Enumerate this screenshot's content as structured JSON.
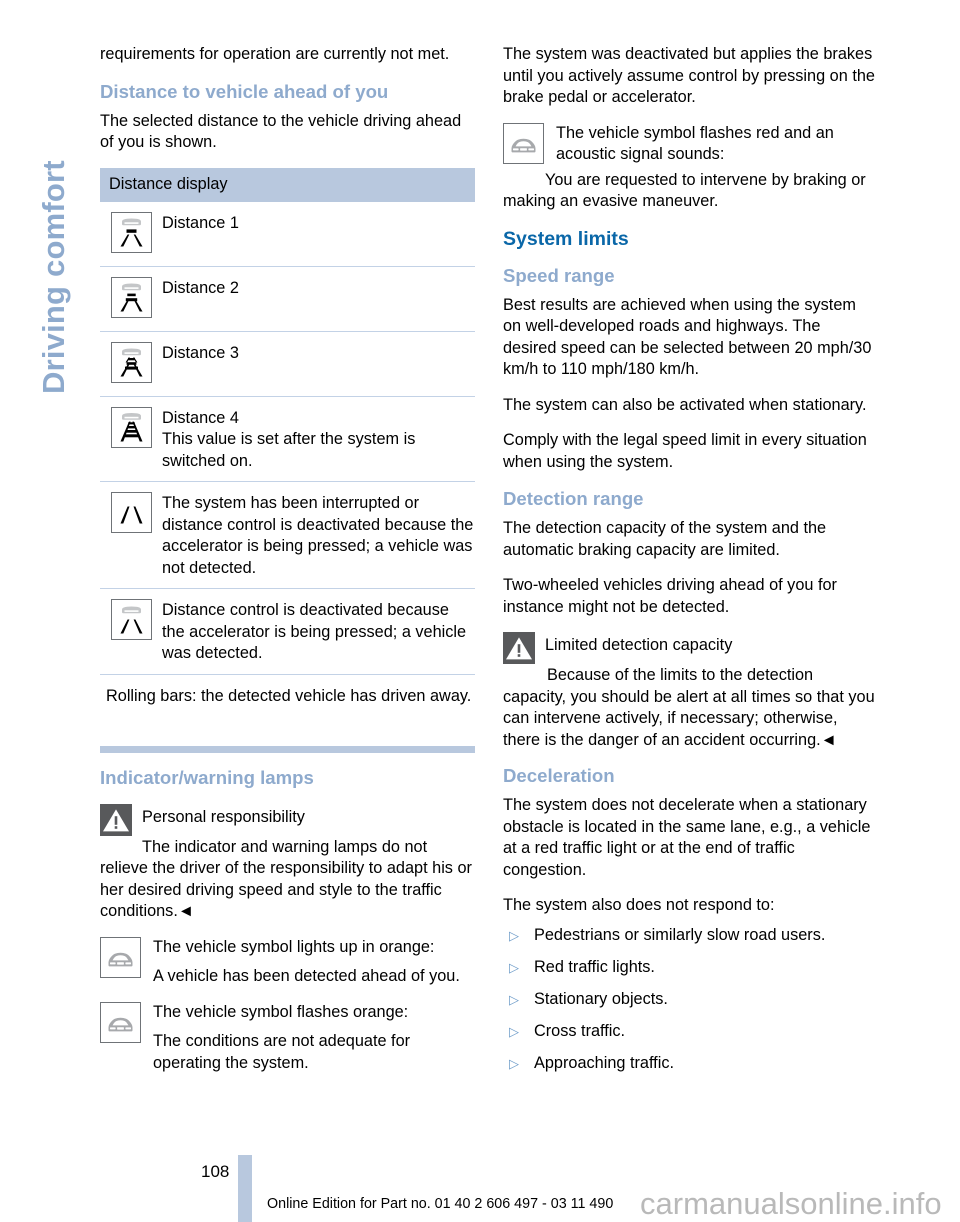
{
  "sidebar": {
    "chapter_label": "Driving comfort",
    "color": "#8eaacd"
  },
  "colors": {
    "head_major": "#0a67a8",
    "head_minor": "#8eaacd",
    "table_header_bg": "#b8c8de",
    "rule": "#c3d2e6",
    "bullet": "#6e9cc9",
    "warn_box": "#58595b",
    "watermark": "#b9b9b9"
  },
  "left_column": {
    "continued_paragraph": "requirements for operation are currently not met.",
    "distance_heading": "Distance to vehicle ahead of you",
    "distance_intro": "The selected distance to the vehicle driving ahead of you is shown.",
    "table": {
      "header": "Distance display",
      "rows": [
        {
          "icon": "distance-1-icon",
          "bars": 1,
          "car": true,
          "title": "Distance 1",
          "note": ""
        },
        {
          "icon": "distance-2-icon",
          "bars": 2,
          "car": true,
          "title": "Distance 2",
          "note": ""
        },
        {
          "icon": "distance-3-icon",
          "bars": 3,
          "car": true,
          "title": "Distance 3",
          "note": ""
        },
        {
          "icon": "distance-4-icon",
          "bars": 4,
          "car": true,
          "title": "Distance 4",
          "note": "This value is set after the system is switched on."
        },
        {
          "icon": "lane-only-icon",
          "bars": 0,
          "car": false,
          "title": "The system has been interrupted or distance control is deactivated because the accelerator is being pressed; a vehicle was not detected.",
          "note": ""
        },
        {
          "icon": "lane-with-car-icon",
          "bars": 0,
          "car": true,
          "title": "Distance control is deactivated because the accelerator is being pressed; a vehicle was detected.",
          "note": ""
        }
      ],
      "footnote": "Rolling bars: the detected vehicle has driven away."
    },
    "lamps_heading": "Indicator/warning lamps",
    "personal_responsibility": {
      "icon": "warning-triangle-icon",
      "title": "Personal responsibility",
      "body": "The indicator and warning lamps do not relieve the driver of the responsibility to adapt his or her desired driving speed and style to the traffic conditions.◄"
    },
    "lamp_rows": [
      {
        "icon": "vehicle-front-icon",
        "line1": "The vehicle symbol lights up in orange:",
        "line2": "A vehicle has been detected ahead of you."
      },
      {
        "icon": "vehicle-front-icon",
        "line1": "The vehicle symbol flashes orange:",
        "line2": "The conditions are not adequate for operating the system."
      }
    ]
  },
  "right_column": {
    "deactivated_paragraph": "The system was deactivated but applies the brakes until you actively assume control by pressing on the brake pedal or accelerator.",
    "flash_red_lamp": {
      "icon": "vehicle-front-icon",
      "line1": "The vehicle symbol flashes red and an acoustic signal sounds:",
      "line2": "You are requested to intervene by braking or making an evasive maneuver."
    },
    "system_limits_heading": "System limits",
    "speed_range": {
      "heading": "Speed range",
      "paragraphs": [
        "Best results are achieved when using the system on well-developed roads and highways. The desired speed can be selected between 20 mph/30 km/h to 110 mph/180 km/h.",
        "The system can also be activated when stationary.",
        "Comply with the legal speed limit in every situation when using the system."
      ]
    },
    "detection_range": {
      "heading": "Detection range",
      "paragraphs": [
        "The detection capacity of the system and the automatic braking capacity are limited.",
        "Two-wheeled vehicles driving ahead of you for instance might not be detected."
      ],
      "notice": {
        "icon": "warning-triangle-icon",
        "title": "Limited detection capacity",
        "body": "Because of the limits to the detection capacity, you should be alert at all times so that you can intervene actively, if necessary; otherwise, there is the danger of an accident occurring.◄"
      }
    },
    "deceleration": {
      "heading": "Deceleration",
      "paragraphs": [
        "The system does not decelerate when a stationary obstacle is located in the same lane, e.g., a vehicle at a red traffic light or at the end of traffic congestion.",
        "The system also does not respond to:"
      ],
      "bullet_marker": "▷",
      "bullets": [
        "Pedestrians or similarly slow road users.",
        "Red traffic lights.",
        "Stationary objects.",
        "Cross traffic.",
        "Approaching traffic."
      ]
    }
  },
  "footer": {
    "page_number": "108",
    "edition_text": "Online Edition for Part no. 01 40 2 606 497 - 03 11 490",
    "watermark": "carmanualsonline.info"
  }
}
